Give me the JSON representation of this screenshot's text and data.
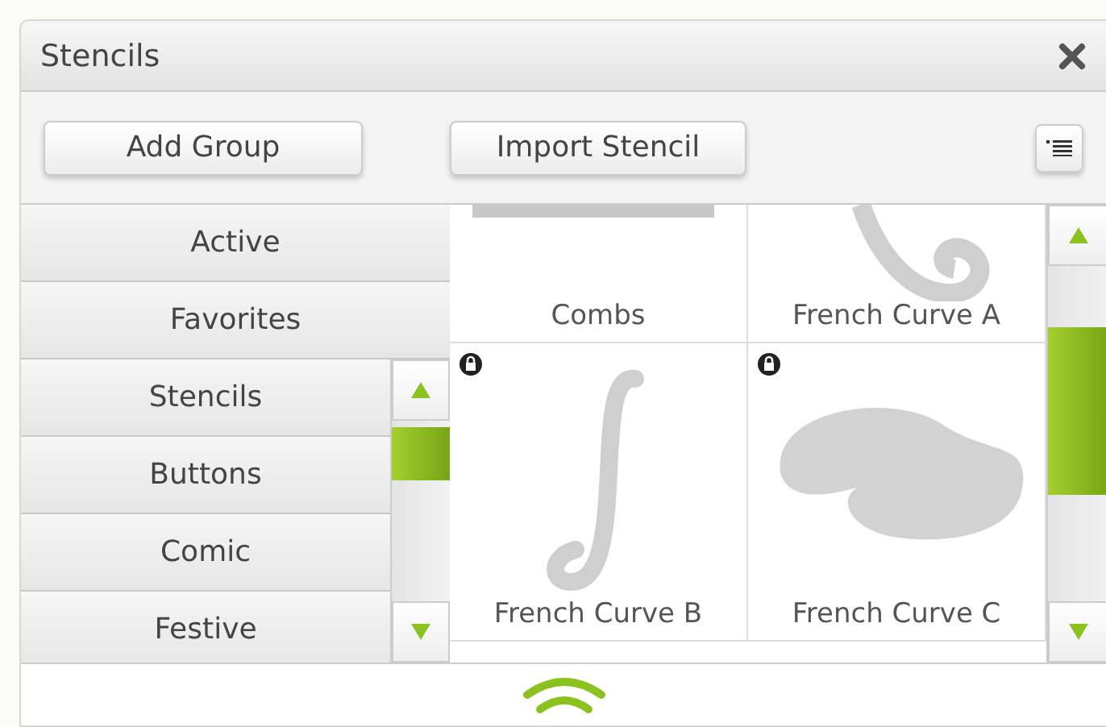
{
  "window": {
    "title": "Stencils"
  },
  "toolbar": {
    "buttons": [
      "Add Group",
      "Import Stencil"
    ]
  },
  "groups": {
    "pinned": [
      "Active",
      "Favorites"
    ],
    "scrolling": [
      "Stencils",
      "Buttons",
      "Comic",
      "Festive"
    ]
  },
  "stencils": [
    {
      "name": "Combs",
      "kind": "combs",
      "locked": false
    },
    {
      "name": "French Curve A",
      "kind": "curve-a",
      "locked": false
    },
    {
      "name": "French Curve B",
      "kind": "curve-b",
      "locked": true
    },
    {
      "name": "French Curve C",
      "kind": "curve-c",
      "locked": true
    }
  ]
}
